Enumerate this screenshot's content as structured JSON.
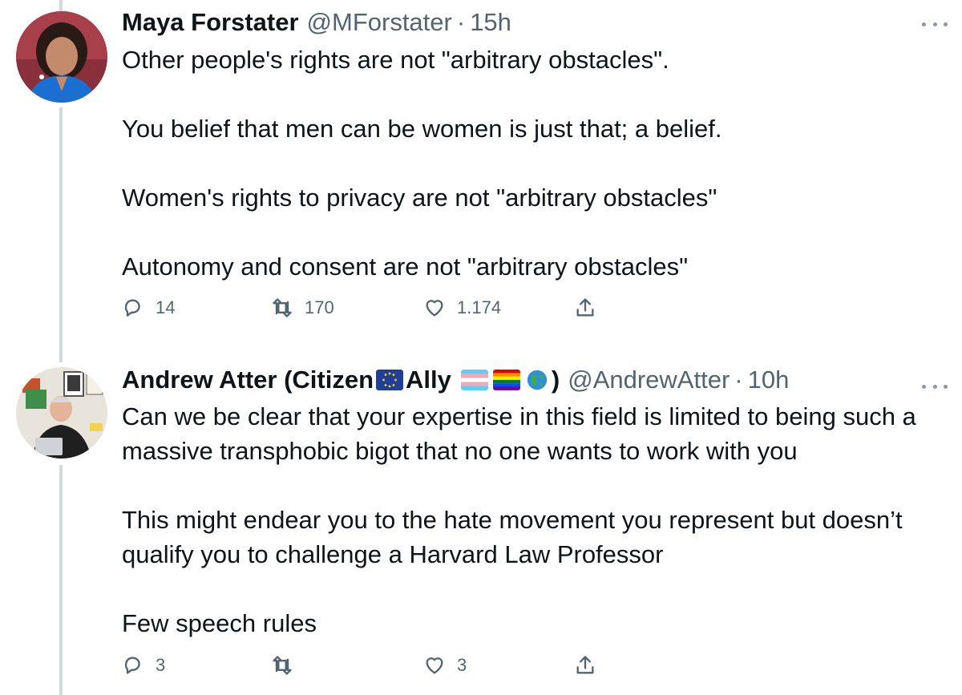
{
  "tweets": [
    {
      "name": "Maya Forstater",
      "handle": "@MForstater",
      "separator": "·",
      "time": "15h",
      "paragraphs": [
        "Other people's rights are not \"arbitrary obstacles\".",
        "You belief that men can be women is just that; a belief.",
        "Women's rights to privacy are not \"arbitrary obstacles\"",
        "Autonomy and consent are not \"arbitrary obstacles\""
      ],
      "replies": "14",
      "retweets": "170",
      "likes": "1.174"
    },
    {
      "name_part1": "Andrew Atter (Citizen",
      "name_part2": "Ally",
      "name_part3": ")",
      "handle": "@AndrewAtter",
      "separator": "·",
      "time": "10h",
      "paragraphs": [
        "Can we be clear that your expertise in this field is limited to being such a massive transphobic bigot that no one wants to work with you",
        "This might endear you to the hate movement you represent but doesn’t qualify you to challenge a Harvard Law Professor",
        "Few speech rules"
      ],
      "replies": "3",
      "retweets": "",
      "likes": "3"
    }
  ],
  "icons": {
    "reply": "reply-icon",
    "retweet": "retweet-icon",
    "like": "heart-icon",
    "share": "share-icon",
    "more": "more-icon",
    "flags": [
      "eu-flag-icon",
      "transgender-flag-icon",
      "rainbow-flag-icon",
      "globe-icon"
    ]
  },
  "colors": {
    "text": "#0f1419",
    "secondary": "#536471",
    "thread_line": "#cfd9de"
  }
}
